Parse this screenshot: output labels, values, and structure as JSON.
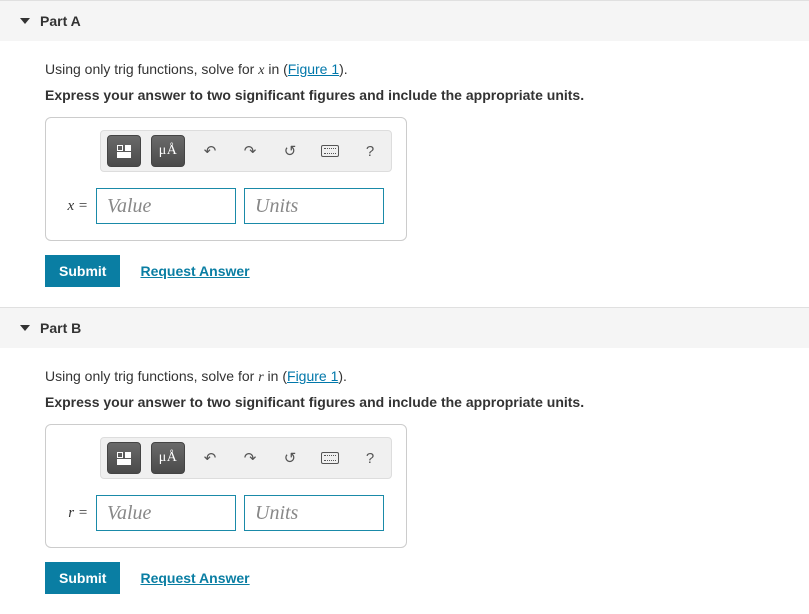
{
  "parts": [
    {
      "title": "Part A",
      "instr_prefix": "Using only trig functions, solve for ",
      "variable": "x",
      "instr_mid": " in (",
      "figure_link": "Figure 1",
      "instr_suffix": ").",
      "hint": "Express your answer to two significant figures and include the appropriate units.",
      "eq_label_var": "x",
      "eq_label_eq": " =",
      "value_ph": "Value",
      "units_ph": "Units",
      "submit": "Submit",
      "request": "Request Answer",
      "tool_ua": "μÅ"
    },
    {
      "title": "Part B",
      "instr_prefix": "Using only trig functions, solve for ",
      "variable": "r",
      "instr_mid": " in (",
      "figure_link": "Figure 1",
      "instr_suffix": ").",
      "hint": "Express your answer to two significant figures and include the appropriate units.",
      "eq_label_var": "r",
      "eq_label_eq": " =",
      "value_ph": "Value",
      "units_ph": "Units",
      "submit": "Submit",
      "request": "Request Answer",
      "tool_ua": "μÅ"
    }
  ]
}
